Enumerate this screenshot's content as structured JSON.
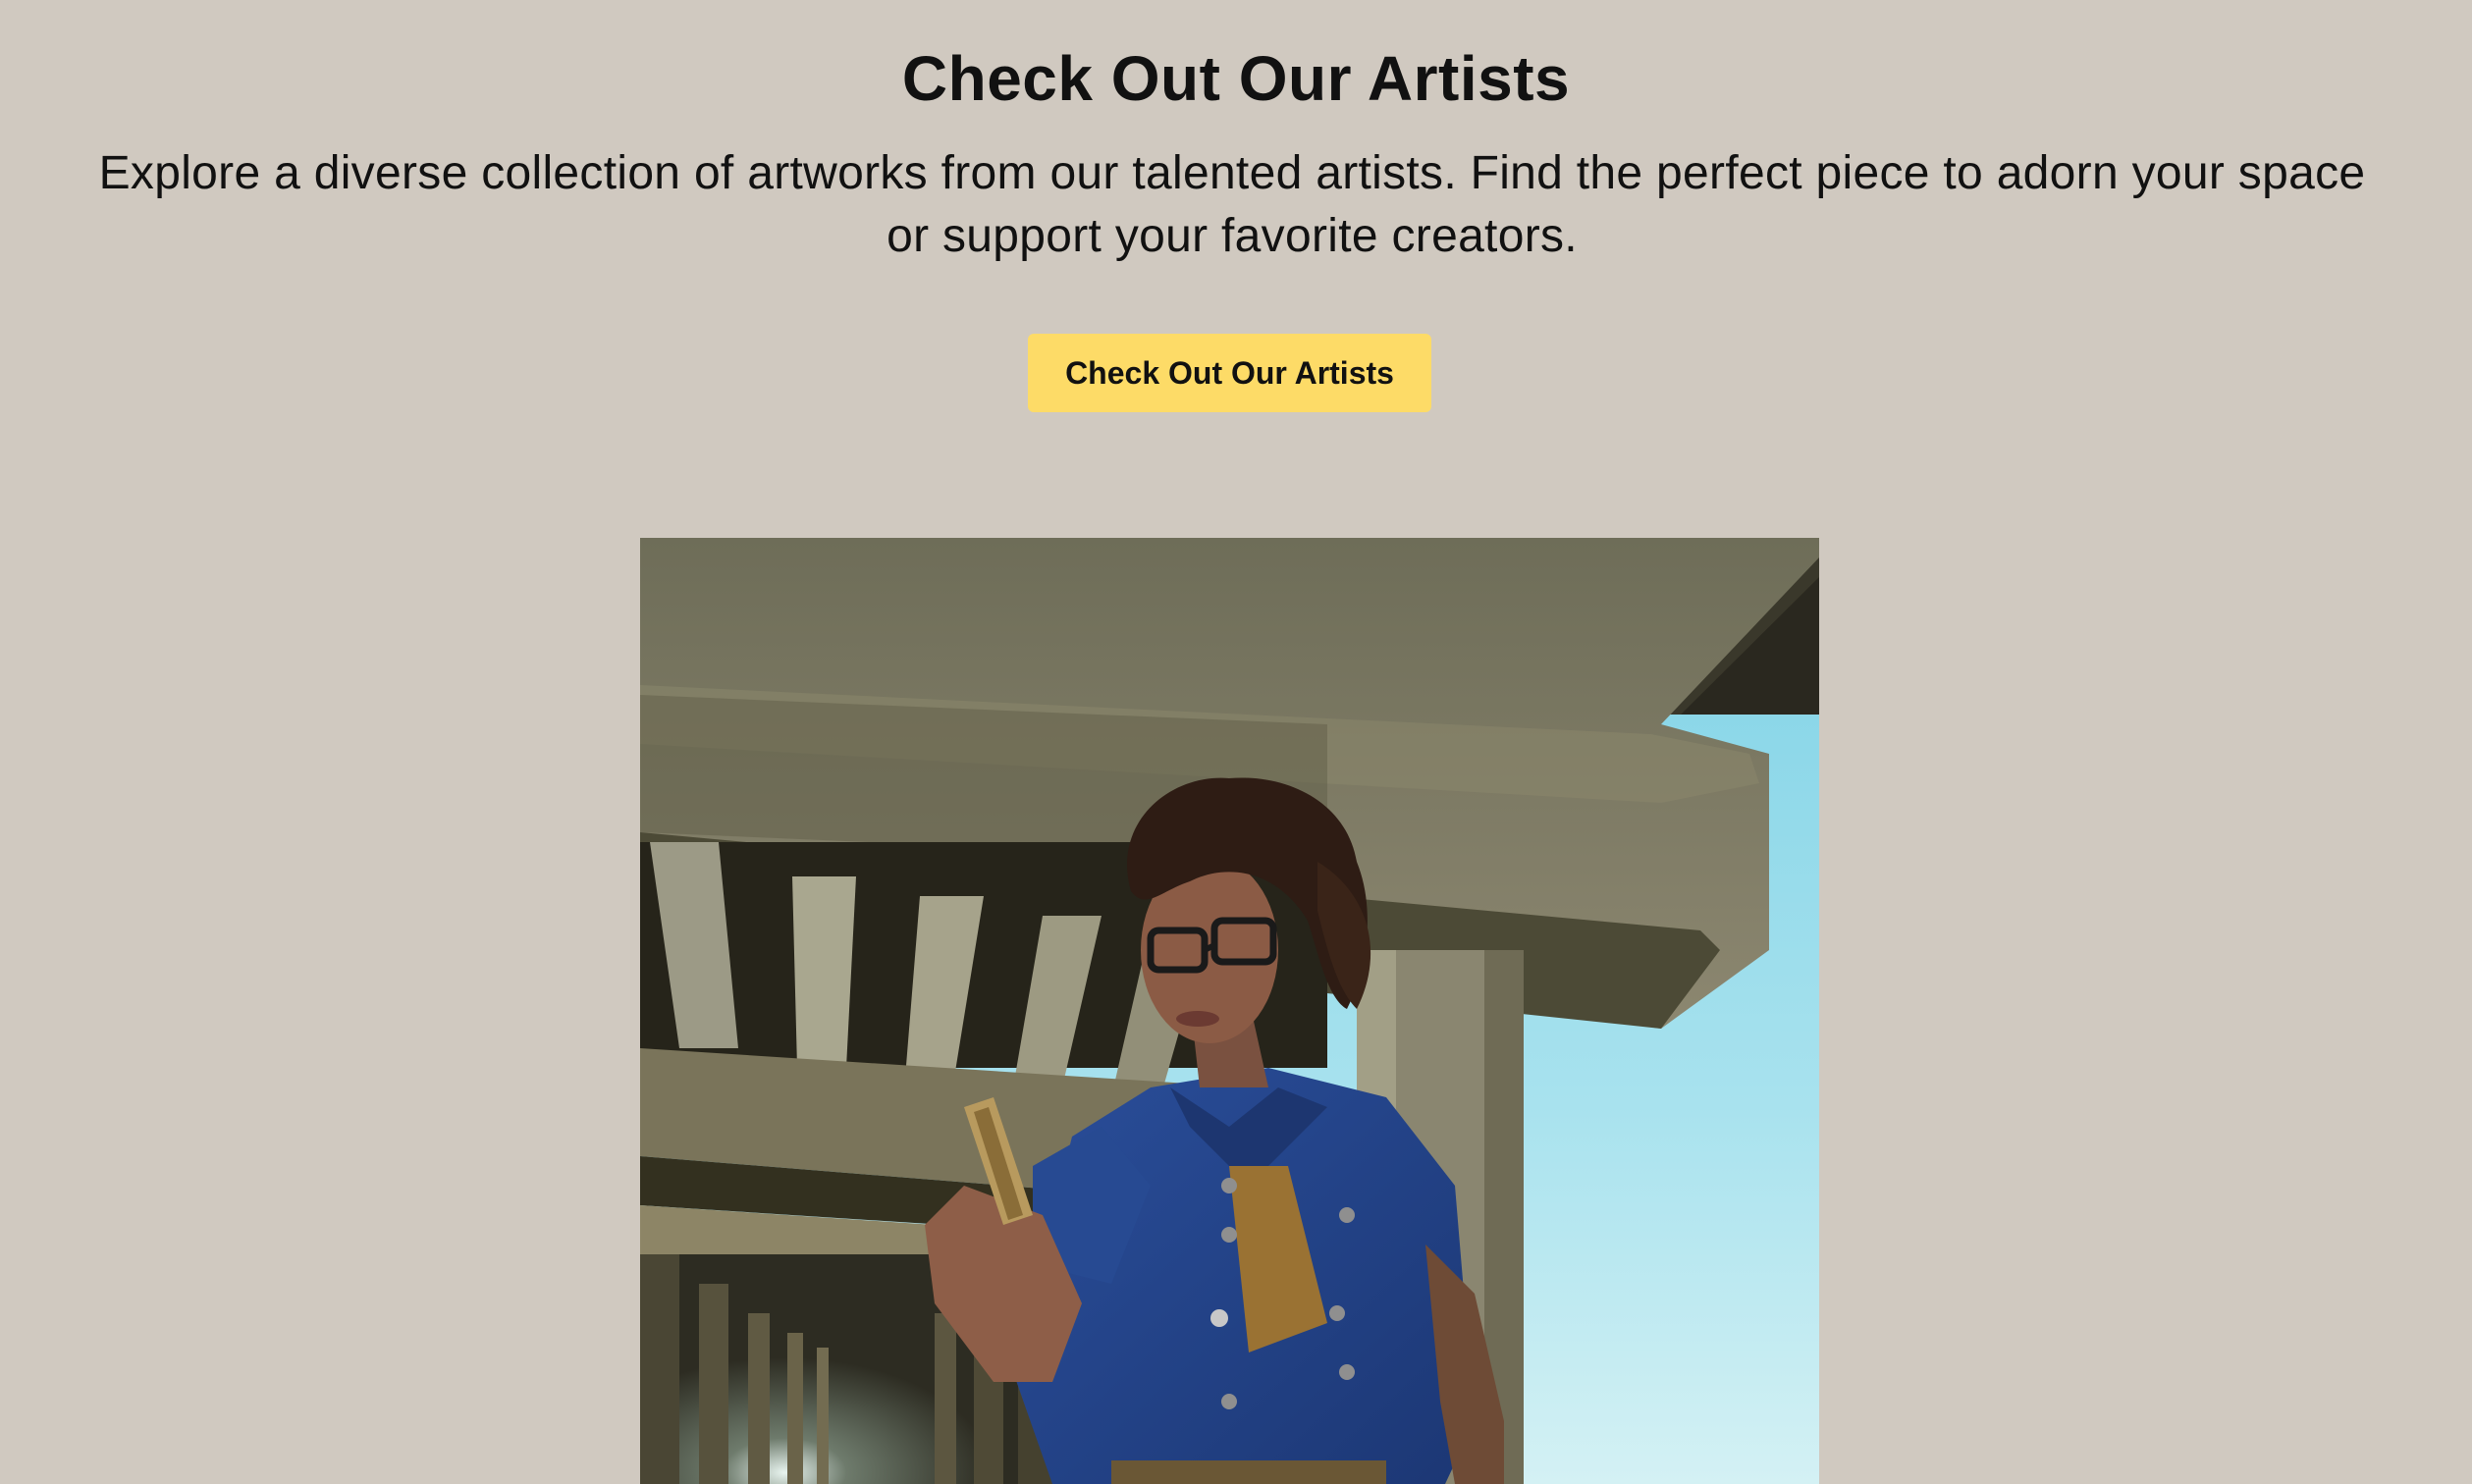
{
  "hero": {
    "title": "Check Out Our Artists",
    "subtitle": "Explore a diverse collection of artworks from our talented artists. Find the perfect piece to adorn your space or support your favorite creators.",
    "cta_label": "Check Out Our Artists"
  },
  "colors": {
    "background": "#d0c9c0",
    "cta_background": "#fddb67",
    "text": "#111111"
  }
}
